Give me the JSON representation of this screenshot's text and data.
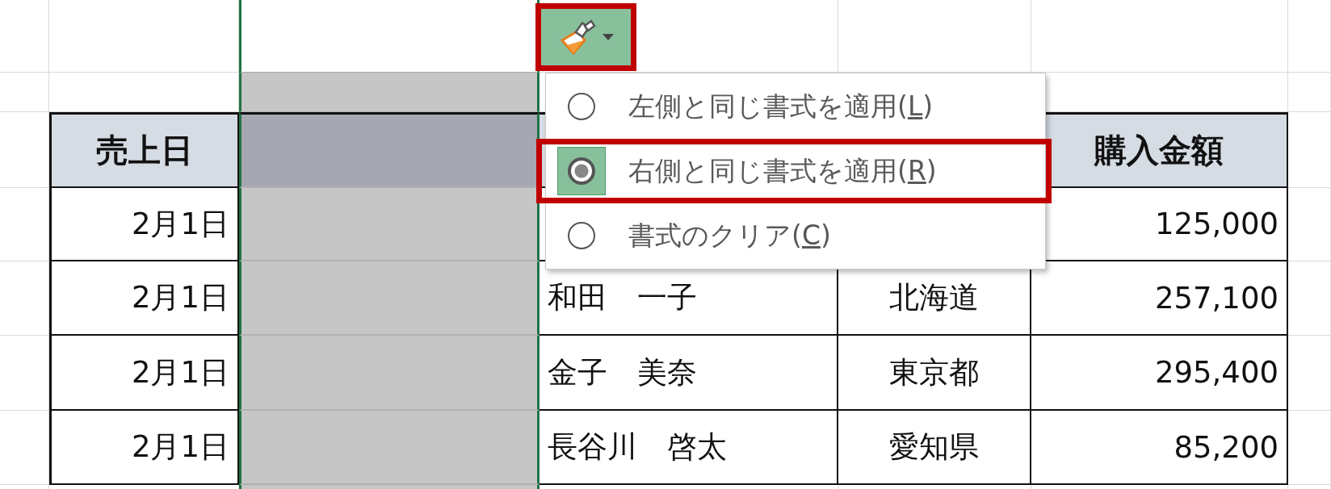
{
  "paste_options_button": {
    "highlighted": true
  },
  "menu": {
    "items": [
      {
        "prefix": "左側と同じ書式を適用(",
        "key": "L",
        "suffix": ")",
        "selected": false
      },
      {
        "prefix": "右側と同じ書式を適用(",
        "key": "R",
        "suffix": ")",
        "selected": true
      },
      {
        "prefix": "書式のクリア(",
        "key": "C",
        "suffix": ")",
        "selected": false
      }
    ]
  },
  "table": {
    "columns": [
      "売上日",
      "",
      "",
      "",
      "購入金額"
    ],
    "rows": [
      {
        "date": "2月1日",
        "amount": "125,000"
      },
      {
        "date": "2月1日",
        "name": "和田　一子",
        "region": "北海道",
        "amount": "257,100"
      },
      {
        "date": "2月1日",
        "name": "金子　美奈",
        "region": "東京都",
        "amount": "295,400"
      },
      {
        "date": "2月1日",
        "name": "長谷川　啓太",
        "region": "愛知県",
        "amount": "85,200"
      }
    ]
  }
}
